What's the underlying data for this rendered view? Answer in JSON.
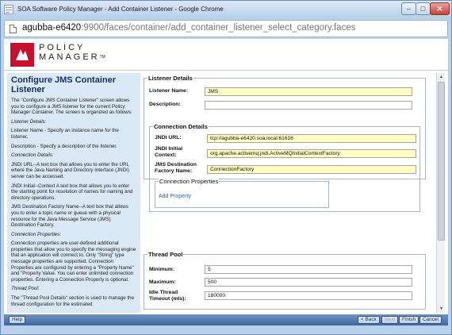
{
  "window": {
    "title": "SOA Software Policy Manager - Add Container Listener - Google Chrome",
    "minimize": "–",
    "maximize": "□",
    "close": "✕"
  },
  "address": {
    "host": "agubba-e6420",
    "rest": ":9900/faces/container/add_container_listener_select_category.faces"
  },
  "logo": {
    "line1": "POLICY",
    "line2": "MANAGER",
    "tm": "TM"
  },
  "help": {
    "title": "Configure JMS Container Listener",
    "paragraphs": [
      {
        "text": "The \"Configure JMS Container Listener\" screen allows you to configure a JMS listener for the current Policy Manager Container. The screen is organized as follows:",
        "italic": false
      },
      {
        "text": "Listener Details:",
        "italic": true
      },
      {
        "text": "Listener Name - Specify an instance name for the listener.",
        "italic": false
      },
      {
        "text": "Description - Specify a description of the listener.",
        "italic": false
      },
      {
        "text": "Connection Details:",
        "italic": true
      },
      {
        "text": "JNDI URL--A text box that allows you to enter the URL where the Java Naming and Directory Interface (JNDI) server can be accessed.",
        "italic": false
      },
      {
        "text": "JNDI Initial--Context A text box that allows you to enter the starting point for resolution of names for naming and directory operations.",
        "italic": false
      },
      {
        "text": "JMS Destination Factory Name--A text box that allows you to enter a topic name or queue with a physical resource for the Java Message Service (JMS) Destination Factory.",
        "italic": false
      },
      {
        "text": "Connection Properties:",
        "italic": true
      },
      {
        "text": "Connection properties are user-defined additional properties that allow you to specify the messaging engine that an application will connect to. Only \"String\" type message properties are supported. Connection Properties are configured by entering a \"Property Name\" and \"Property Value. You can enter unlimited connection properties. Entering a Connection Property is optional.",
        "italic": false
      },
      {
        "text": "Thread Pool:",
        "italic": true
      },
      {
        "text": "The \"Thread Pool Details\" section is used to manage the thread configuration for the estimated",
        "italic": false
      }
    ]
  },
  "listener_details": {
    "legend": "Listener Details",
    "name_label": "Listener Name:",
    "name_value": "JMS",
    "description_label": "Description:",
    "description_value": ""
  },
  "connection_details": {
    "legend": "Connection Details",
    "jndi_url_label": "JNDI URL:",
    "jndi_url_value": "tcp://agubba-e6420.soa.local:61616",
    "jndi_initial_label_1": "JNDI Initial",
    "jndi_initial_label_2": "Context:",
    "jndi_initial_value": "org.apache.activemq.jndi.ActiveMQInitialContextFactory",
    "jms_factory_label_1": "JMS Destination",
    "jms_factory_label_2": "Factory Name:",
    "jms_factory_value": "ConnectionFactory",
    "properties_legend": "Connection Properties",
    "add_property": "Add Property"
  },
  "thread_pool": {
    "legend": "Thread Pool",
    "minimum_label": "Minimum:",
    "minimum_value": "5",
    "maximum_label": "Maximum:",
    "maximum_value": "500",
    "idle_label_1": "Idle Thread",
    "idle_label_2": "Timeout (mls):",
    "idle_value": "180000"
  },
  "scrollbar": {
    "up": "▲",
    "down": "▼"
  },
  "footer": {
    "help": "Help",
    "back": "< Back",
    "next": "Next",
    "finish": "Finish",
    "cancel": "Cancel"
  },
  "colors": {
    "brand_red": "#c8102e",
    "required_field": "#ffffc4",
    "help_panel": "#dbe8f5",
    "footer_bar": "#4f77aa",
    "link": "#2a63b8"
  }
}
